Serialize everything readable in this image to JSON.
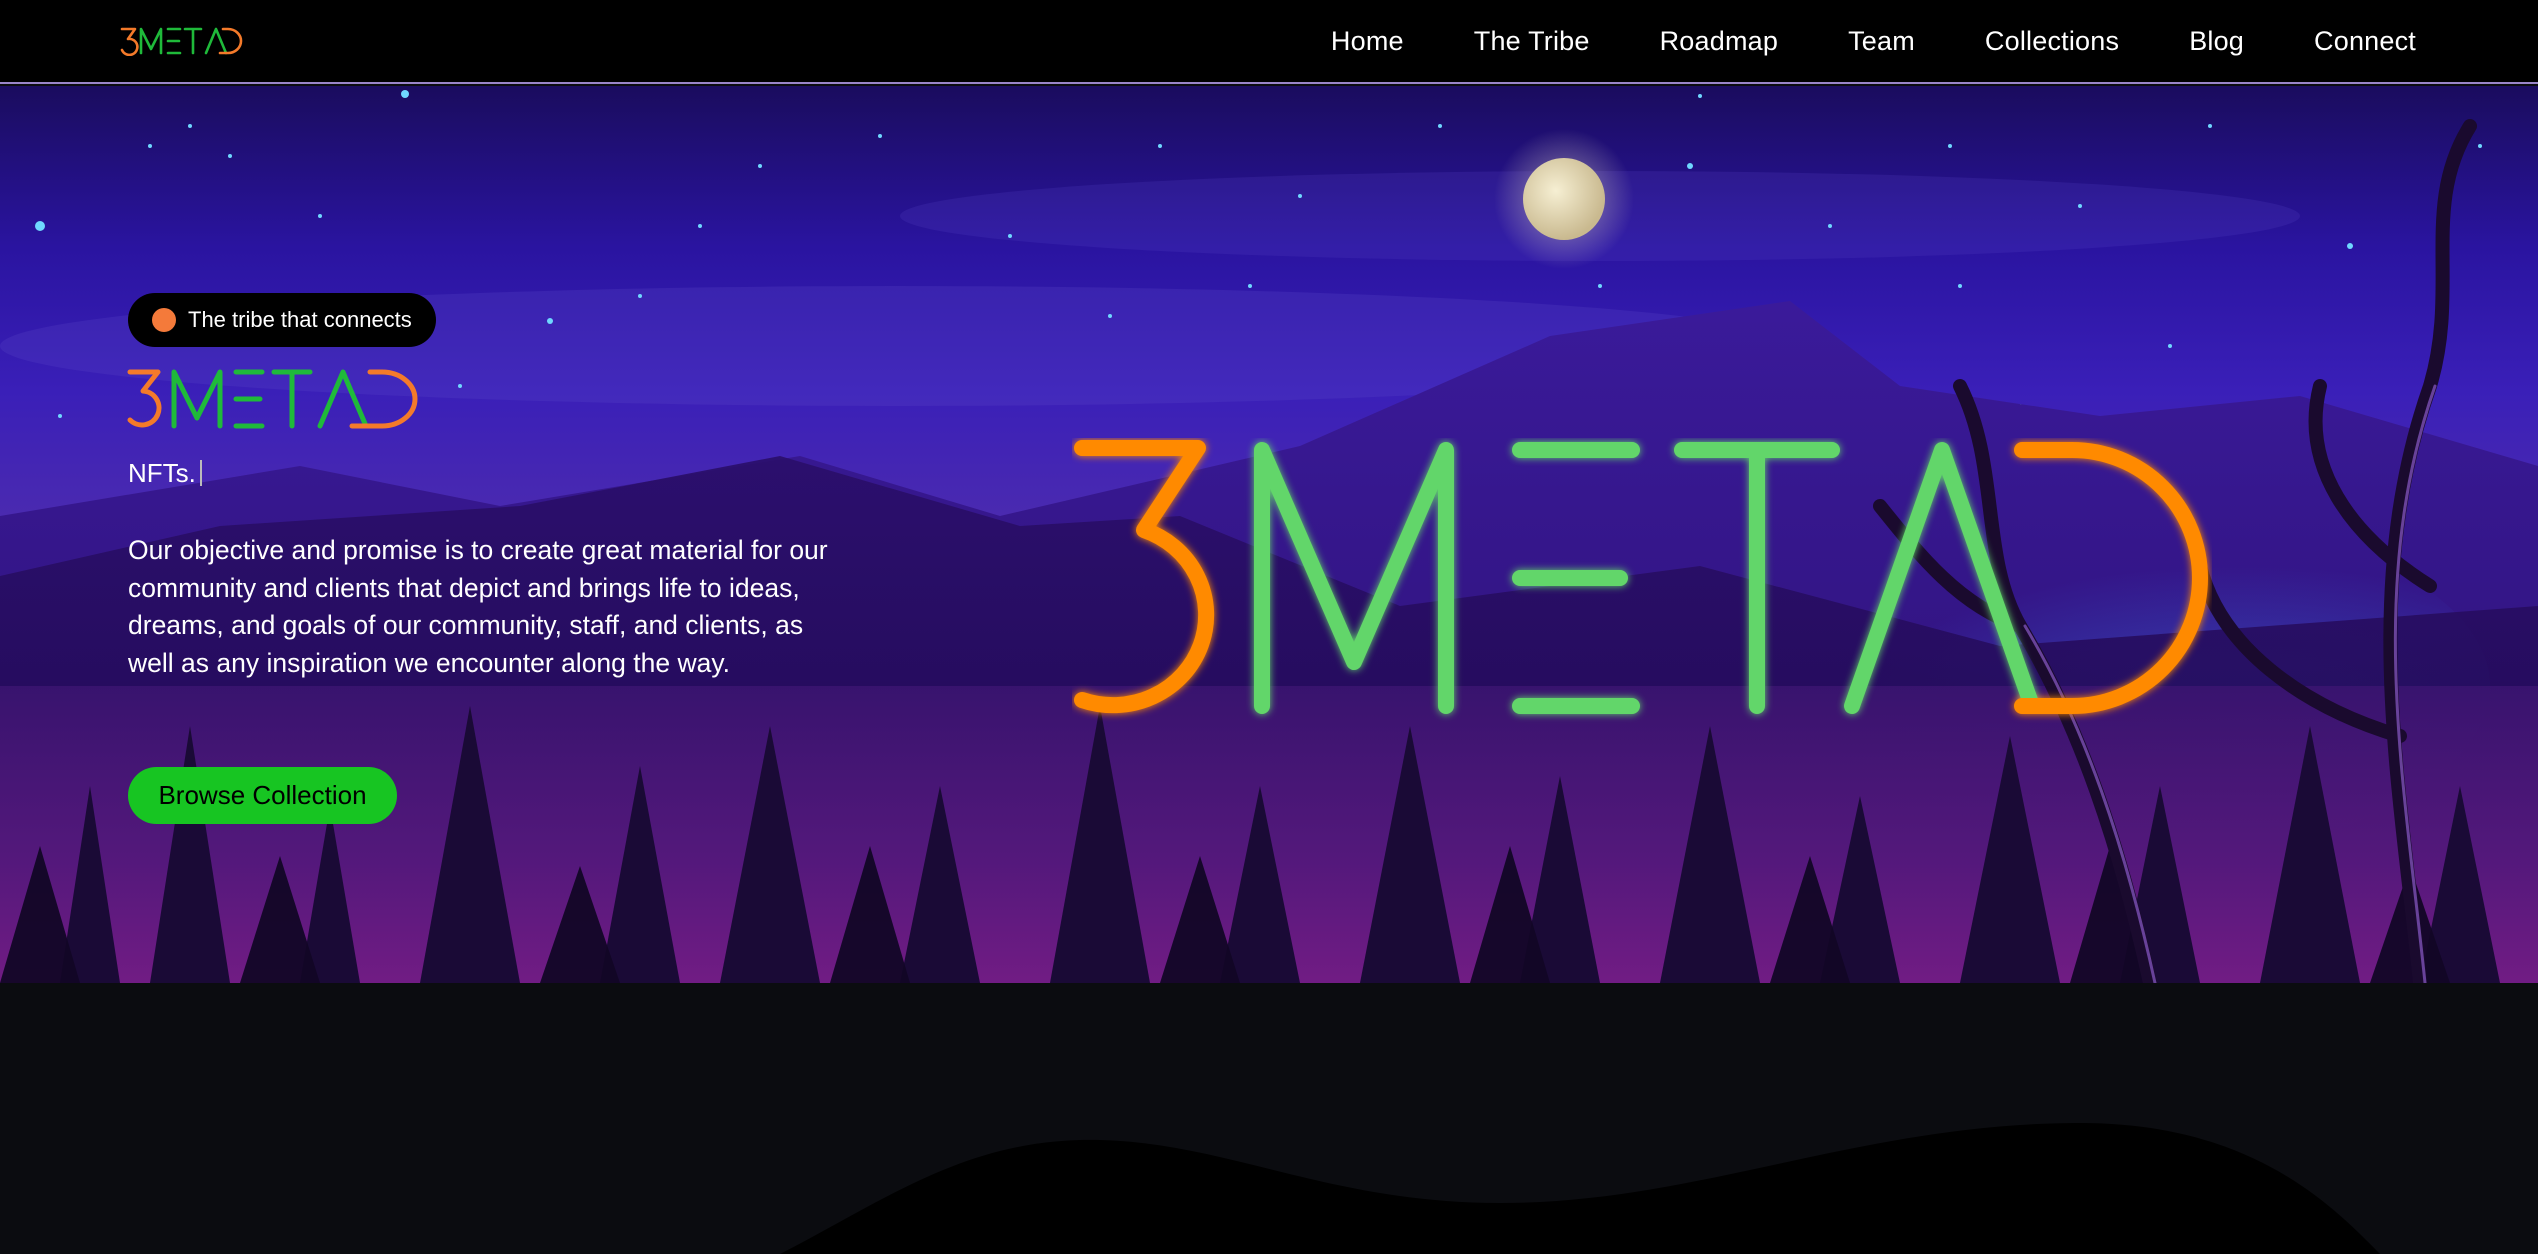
{
  "brand": {
    "name": "3METAD",
    "colors": {
      "orange": "#f47a2a",
      "green": "#1fba3a",
      "green_light": "#62d66a"
    }
  },
  "nav": {
    "items": [
      {
        "label": "Home"
      },
      {
        "label": "The Tribe"
      },
      {
        "label": "Roadmap"
      },
      {
        "label": "Team"
      },
      {
        "label": "Collections"
      },
      {
        "label": "Blog"
      },
      {
        "label": "Connect"
      }
    ]
  },
  "hero": {
    "badge": "The tribe that connects",
    "typed_text": "NFTs.",
    "description": "Our objective and promise is to create great material for our community and clients that depict and brings life to ideas, dreams, and goals of our community, staff, and clients, as well as any inspiration we encounter along the way.",
    "cta_label": "Browse Collection"
  },
  "colors": {
    "accent_green": "#17c522",
    "badge_dot": "#f47a3a",
    "nav_border": "#9a86c9",
    "page_bg": "#0b0c10"
  }
}
